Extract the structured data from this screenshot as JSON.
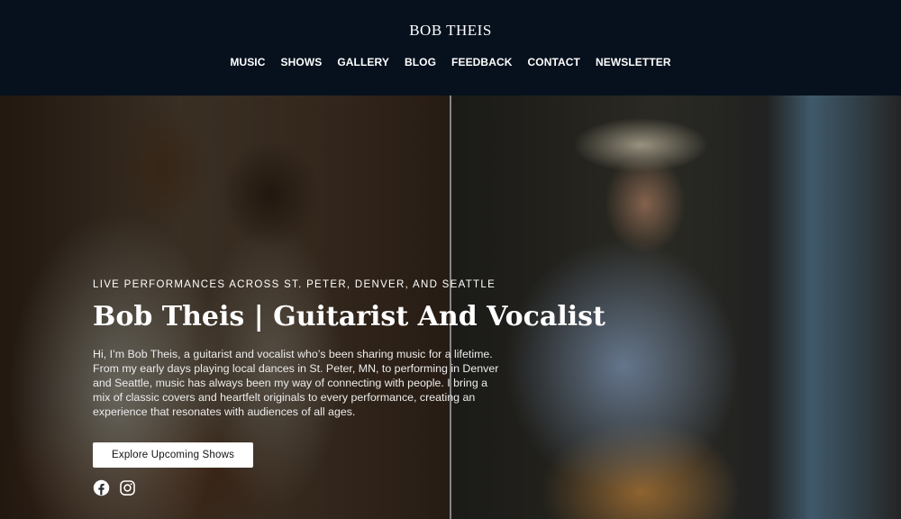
{
  "site": {
    "brand": "BOB THEIS"
  },
  "nav": {
    "items": [
      "MUSIC",
      "SHOWS",
      "GALLERY",
      "BLOG",
      "FEEDBACK",
      "CONTACT",
      "NEWSLETTER"
    ]
  },
  "hero": {
    "eyebrow": "LIVE PERFORMANCES ACROSS ST. PETER, DENVER, AND SEATTLE",
    "title": "Bob Theis | Guitarist And Vocalist",
    "intro": "Hi, I’m Bob Theis, a guitarist and vocalist who’s been sharing music for a lifetime. From my early days playing local dances in St. Peter, MN, to performing in Denver and Seattle, music has always been my way of connecting with people. I bring a mix of classic covers and heartfelt originals to every performance, creating an experience that resonates with audiences of all ages.",
    "cta_label": "Explore Upcoming Shows",
    "socials": [
      "facebook-icon",
      "instagram-icon"
    ]
  },
  "colors": {
    "header_bg": "#06111d",
    "text": "#ffffff",
    "button_bg": "#ffffff"
  }
}
